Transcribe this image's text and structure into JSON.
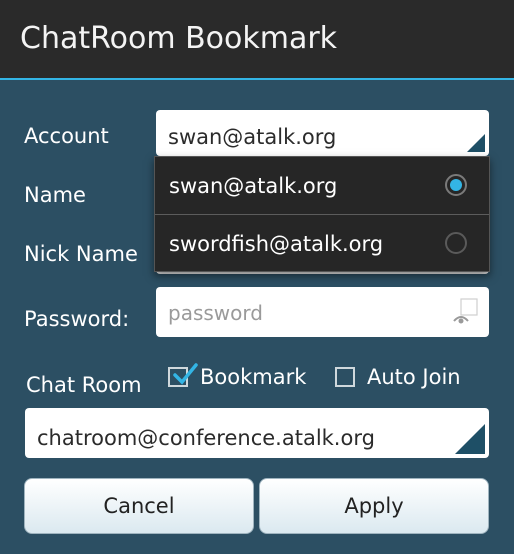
{
  "dialog": {
    "title": "ChatRoom Bookmark"
  },
  "form": {
    "account_label": "Account",
    "account_value": "swan@atalk.org",
    "name_label": "Name",
    "nick_label": "Nick Name",
    "password_label": "Password:",
    "password_placeholder": "password",
    "chatroom_label": "Chat Room",
    "bookmark_label": "Bookmark",
    "bookmark_checked": true,
    "autojoin_label": "Auto Join",
    "autojoin_checked": false,
    "chatroom_value": "chatroom@conference.atalk.org"
  },
  "account_dropdown": {
    "options": [
      {
        "label": "swan@atalk.org",
        "selected": true
      },
      {
        "label": "swordfish@atalk.org",
        "selected": false
      }
    ]
  },
  "buttons": {
    "cancel": "Cancel",
    "apply": "Apply"
  },
  "colors": {
    "background": "#2c4f63",
    "titlebar": "#2a2a2a",
    "accent": "#33b5e5"
  }
}
